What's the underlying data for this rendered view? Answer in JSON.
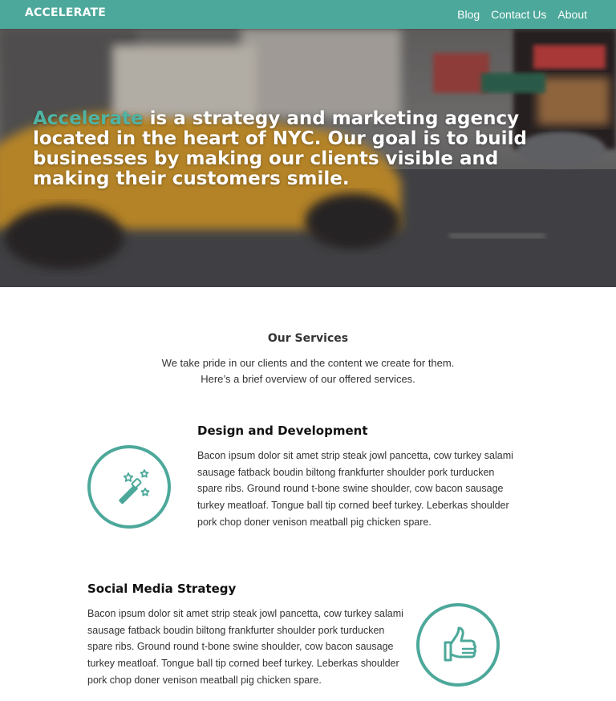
{
  "nav": {
    "logo": "ACCELERATE",
    "links": [
      "Blog",
      "Contact Us",
      "About"
    ]
  },
  "hero": {
    "accent_word": "Accelerate",
    "text": " is a strategy and marketing agency located in the heart of NYC. Our goal is to build businesses by making our clients visible and making their customers smile."
  },
  "services": {
    "title": "Our Services",
    "intro_line1": "We take pride in our clients and the content we create for them.",
    "intro_line2": "Here’s a brief overview of our offered services.",
    "items": [
      {
        "heading": "Design and Development",
        "icon": "magic-wand-icon",
        "description": "Bacon ipsum dolor sit amet strip steak jowl pancetta, cow turkey salami sausage fatback boudin biltong frankfurter shoulder pork turducken spare ribs. Ground round t-bone swine shoulder, cow bacon sausage turkey meatloaf. Tongue ball tip corned beef turkey. Leberkas shoulder pork chop doner venison meatball pig chicken spare."
      },
      {
        "heading": "Social Media Strategy",
        "icon": "thumbs-up-icon",
        "description": "Bacon ipsum dolor sit amet strip steak jowl pancetta, cow turkey salami sausage fatback boudin biltong frankfurter shoulder pork turducken spare ribs. Ground round t-bone swine shoulder, cow bacon sausage turkey meatloaf. Tongue ball tip corned beef turkey. Leberkas shoulder pork chop doner venison meatball pig chicken spare."
      }
    ]
  },
  "colors": {
    "brand": "#4ca89a",
    "accent_text": "#4fb3a4",
    "text": "#333333"
  }
}
